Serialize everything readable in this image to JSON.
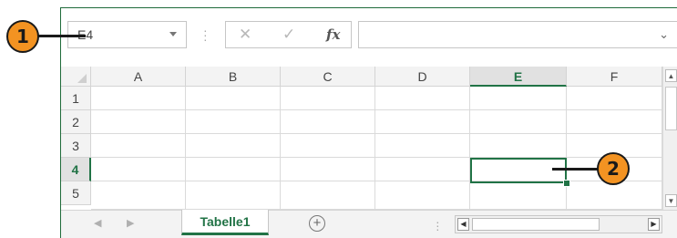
{
  "formula_bar": {
    "name_box_value": "E4",
    "cancel_icon": "✕",
    "enter_icon": "✓",
    "function_icon": "fx",
    "formula_value": ""
  },
  "columns": [
    "A",
    "B",
    "C",
    "D",
    "E",
    "F"
  ],
  "rows": [
    "1",
    "2",
    "3",
    "4",
    "5"
  ],
  "active_cell": {
    "column": "E",
    "row": "4"
  },
  "sheet_tabs": {
    "active_label": "Tabelle1"
  },
  "callouts": {
    "one": "1",
    "two": "2"
  },
  "colors": {
    "accent": "#217346",
    "callout": "#f39322"
  }
}
